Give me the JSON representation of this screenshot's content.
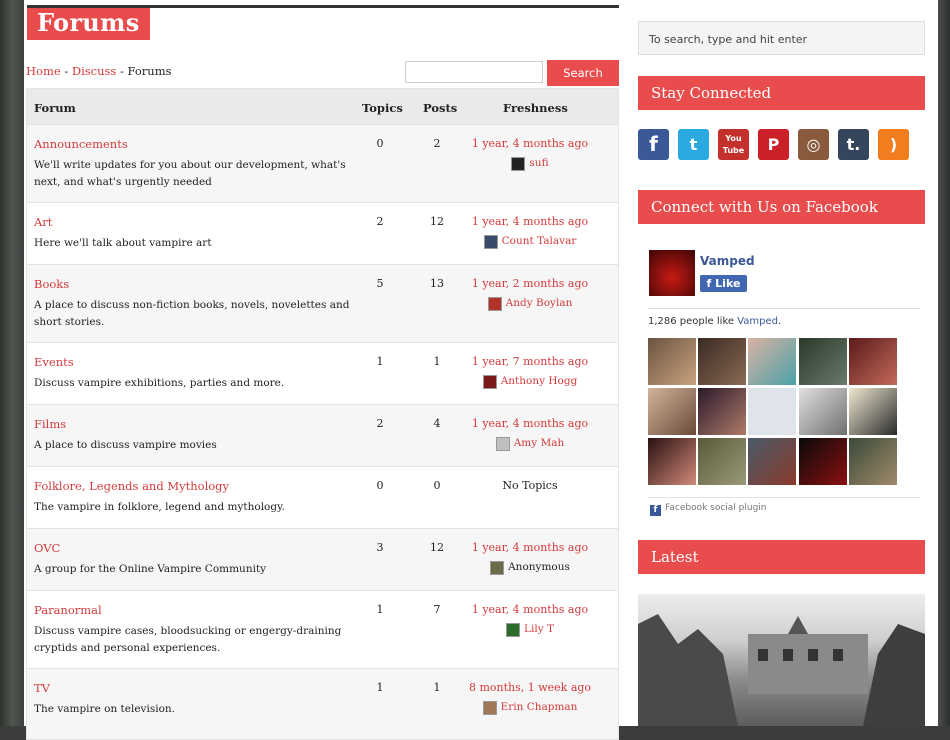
{
  "page": {
    "title": "Forums",
    "breadcrumb": {
      "home": "Home",
      "sep1": " - ",
      "discuss": "Discuss",
      "sep2": " - ",
      "current": "Forums"
    },
    "search_button": "Search"
  },
  "table": {
    "headers": {
      "forum": "Forum",
      "topics": "Topics",
      "posts": "Posts",
      "freshness": "Freshness"
    },
    "rows": [
      {
        "name": "Announcements",
        "desc": "We'll write updates for you about our development, what's next, and what's urgently needed",
        "topics": "0",
        "posts": "2",
        "freshness": "1 year, 4 months ago",
        "user": "sufi"
      },
      {
        "name": "Art",
        "desc": "Here we'll talk about vampire art",
        "topics": "2",
        "posts": "12",
        "freshness": "1 year, 4 months ago",
        "user": "Count Talavar"
      },
      {
        "name": "Books",
        "desc": "A place to discuss non-fiction books, novels, novelettes and short stories.",
        "topics": "5",
        "posts": "13",
        "freshness": "1 year, 2 months ago",
        "user": "Andy Boylan"
      },
      {
        "name": "Events",
        "desc": "Discuss vampire exhibitions, parties and more.",
        "topics": "1",
        "posts": "1",
        "freshness": "1 year, 7 months ago",
        "user": "Anthony Hogg"
      },
      {
        "name": "Films",
        "desc": "A place to discuss vampire movies",
        "topics": "2",
        "posts": "4",
        "freshness": "1 year, 4 months ago",
        "user": "Amy Mah"
      },
      {
        "name": "Folklore, Legends and Mythology",
        "desc": "The vampire in folklore, legend and mythology.",
        "topics": "0",
        "posts": "0",
        "freshness": "No Topics",
        "user": ""
      },
      {
        "name": "OVC",
        "desc": "A group for the Online Vampire Community",
        "topics": "3",
        "posts": "12",
        "freshness": "1 year, 4 months ago",
        "user": "Anonymous"
      },
      {
        "name": "Paranormal",
        "desc": "Discuss vampire cases, bloodsucking or engergy-draining cryptids and personal experiences.",
        "topics": "1",
        "posts": "7",
        "freshness": "1 year, 4 months ago",
        "user": "Lily T"
      },
      {
        "name": "TV",
        "desc": "The vampire on television.",
        "topics": "1",
        "posts": "1",
        "freshness": "8 months, 1 week ago",
        "user": "Erin Chapman"
      }
    ]
  },
  "sidebar": {
    "search_placeholder": "To search, type and hit enter",
    "stay_connected": "Stay Connected",
    "social": [
      {
        "icon": "facebook-icon",
        "glyph": "f",
        "color": "#3b5998"
      },
      {
        "icon": "twitter-icon",
        "glyph": "t",
        "color": "#2ba9e1"
      },
      {
        "icon": "youtube-icon",
        "glyph": "You Tube",
        "color": "#c4302b"
      },
      {
        "icon": "pinterest-icon",
        "glyph": "P",
        "color": "#cb2027"
      },
      {
        "icon": "instagram-icon",
        "glyph": "◎",
        "color": "#8a5a3c"
      },
      {
        "icon": "tumblr-icon",
        "glyph": "t.",
        "color": "#35465c"
      },
      {
        "icon": "rss-icon",
        "glyph": ")",
        "color": "#f27d1e"
      }
    ],
    "facebook_title": "Connect with Us on Facebook",
    "facebook": {
      "page_name": "Vamped",
      "like_label": "Like",
      "count_text": "1,286 people like ",
      "count_page": "Vamped",
      "count_end": ".",
      "plugin_label": "Facebook social plugin"
    },
    "latest_title": "Latest"
  },
  "colors": {
    "accent": "#e84c4c",
    "link": "#d23b3b",
    "facebook": "#3b5998"
  }
}
